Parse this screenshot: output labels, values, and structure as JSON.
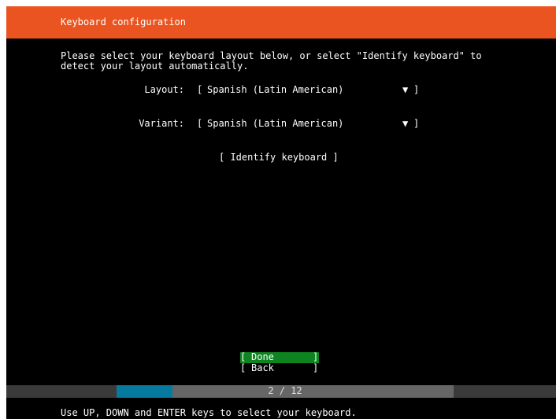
{
  "header": {
    "title": "Keyboard configuration",
    "color": "#e95420"
  },
  "intro": {
    "line1": "Please select your keyboard layout below, or select \"Identify keyboard\" to",
    "line2": "detect your layout automatically."
  },
  "layout_field": {
    "label": "Layout:",
    "open_bracket": "[",
    "value": "Spanish (Latin American)",
    "arrow": "▼",
    "close_bracket": "]"
  },
  "variant_field": {
    "label": "Variant:",
    "open_bracket": "[",
    "value": "Spanish (Latin American)",
    "arrow": "▼",
    "close_bracket": "]"
  },
  "identify_button": {
    "label": "[ Identify keyboard ]"
  },
  "buttons": {
    "done": {
      "open": "[",
      "label": "Done",
      "close": "]",
      "color": "#0e8420"
    },
    "back": {
      "open": "[",
      "label": "Back",
      "close": "]"
    }
  },
  "progress": {
    "text": "2 / 12",
    "current": 2,
    "total": 12,
    "fraction": 0.167,
    "fill_color": "#06799f"
  },
  "footer": {
    "help_text": "Use UP, DOWN and ENTER keys to select your keyboard."
  }
}
